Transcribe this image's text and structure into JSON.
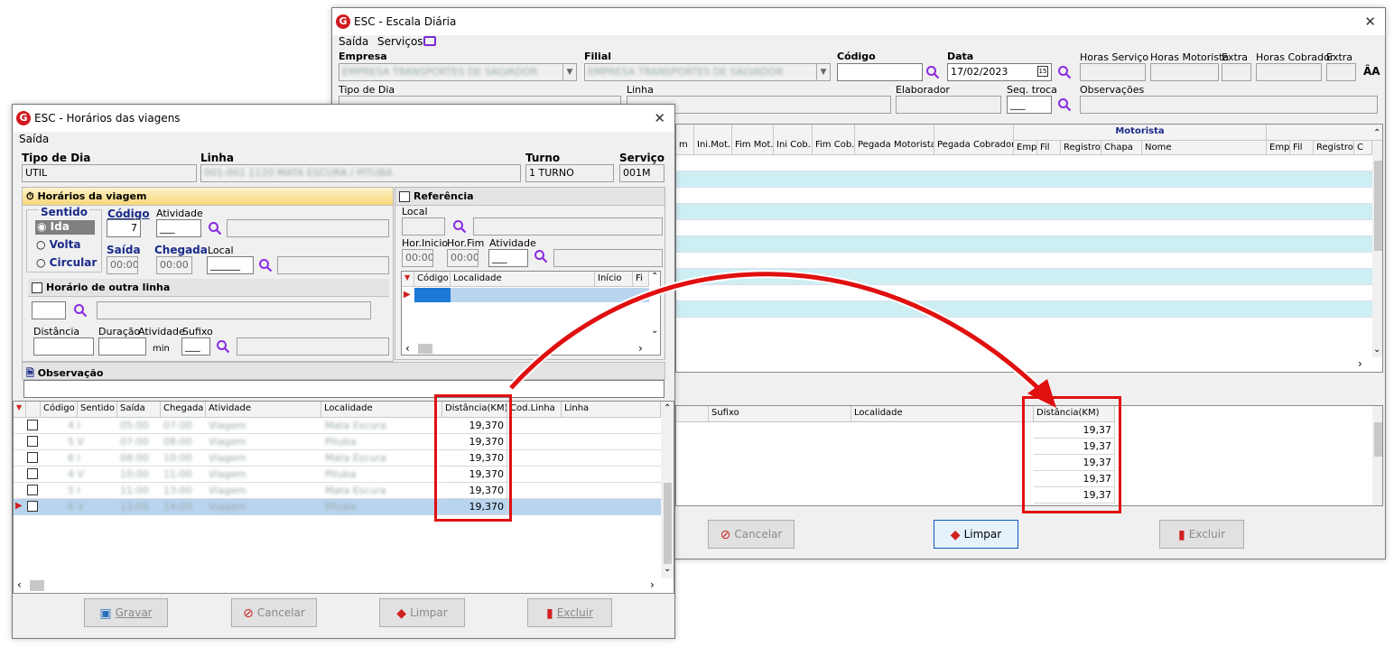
{
  "back_window": {
    "title": "ESC - Escala Diária",
    "menu": [
      "Saída",
      "Serviços"
    ],
    "labels": {
      "empresa": "Empresa",
      "filial": "Filial",
      "codigo": "Código",
      "data": "Data",
      "horas_servico": "Horas Serviço",
      "horas_motorista": "Horas Motorista",
      "extra1": "Extra",
      "horas_cobrador": "Horas Cobrador",
      "extra2": "Extra",
      "tipo_dia": "Tipo de Dia",
      "linha": "Linha",
      "elaborador": "Elaborador",
      "seq_troca": "Seq. troca",
      "observacoes": "Observações"
    },
    "data_value": "17/02/2023",
    "seq_troca_value": "___",
    "upper_grid": {
      "group_header": "Motorista",
      "headers": [
        "m",
        "Ini.Mot.",
        "Fim Mot.",
        "Ini Cob.",
        "Fim Cob.",
        "Pegada Motorista",
        "Pegada Cobrador",
        "Emp",
        "Fil",
        "Registro",
        "Chapa",
        "Nome",
        "Emp",
        "Fil",
        "Registro",
        "C"
      ]
    },
    "lower_grid": {
      "headers": [
        "Sufixo",
        "Localidade",
        "Distância(KM)"
      ],
      "distances": [
        "19,37",
        "19,37",
        "19,37",
        "19,37",
        "19,37"
      ]
    },
    "buttons": {
      "cancelar": "Cancelar",
      "limpar": "Limpar",
      "excluir": "Excluir"
    }
  },
  "front_window": {
    "title": "ESC - Horários das viagens",
    "menu": [
      "Saída"
    ],
    "labels": {
      "tipo_dia": "Tipo de Dia",
      "linha": "Linha",
      "turno": "Turno",
      "servico": "Serviço",
      "horarios_viagem": "Horários da viagem",
      "sentido": "Sentido",
      "codigo": "Código",
      "atividade": "Atividade",
      "saida": "Saída",
      "chegada": "Chegada",
      "local": "Local",
      "horario_outra_linha": "Horário de outra linha",
      "distancia": "Distância",
      "duracao": "Duração",
      "atividade2": "Atividade",
      "sufixo": "Sufixo",
      "min": "min",
      "observacao": "Observação",
      "referencia": "Referência",
      "ref_local": "Local",
      "hor_inicio": "Hor.Inicio",
      "hor_fim": "Hor.Fim",
      "ref_atividade": "Atividade"
    },
    "values": {
      "tipo_dia": "UTIL",
      "turno": "1 TURNO",
      "servico": "001M",
      "codigo": "7",
      "atividade": "___",
      "saida": "00:00",
      "chegada": "00:00",
      "local": "______",
      "sufixo": "___",
      "ref_hor_inicio": "00:00",
      "ref_hor_fim": "00:00",
      "ref_atividade": "___"
    },
    "sentido_options": [
      "Ida",
      "Volta",
      "Circular"
    ],
    "ref_grid_headers": [
      "Código",
      "Localidade",
      "Início",
      "Fi"
    ],
    "trip_grid": {
      "headers": [
        "Código",
        "Sentido",
        "Saída",
        "Chegada",
        "Atividade",
        "Localidade",
        "Distância(KM)",
        "Cod.Linha",
        "Linha"
      ],
      "distances": [
        "19,370",
        "19,370",
        "19,370",
        "19,370",
        "19,370",
        "19,370"
      ]
    },
    "buttons": {
      "gravar": "Gravar",
      "cancelar": "Cancelar",
      "limpar": "Limpar",
      "excluir": "Excluir"
    }
  }
}
